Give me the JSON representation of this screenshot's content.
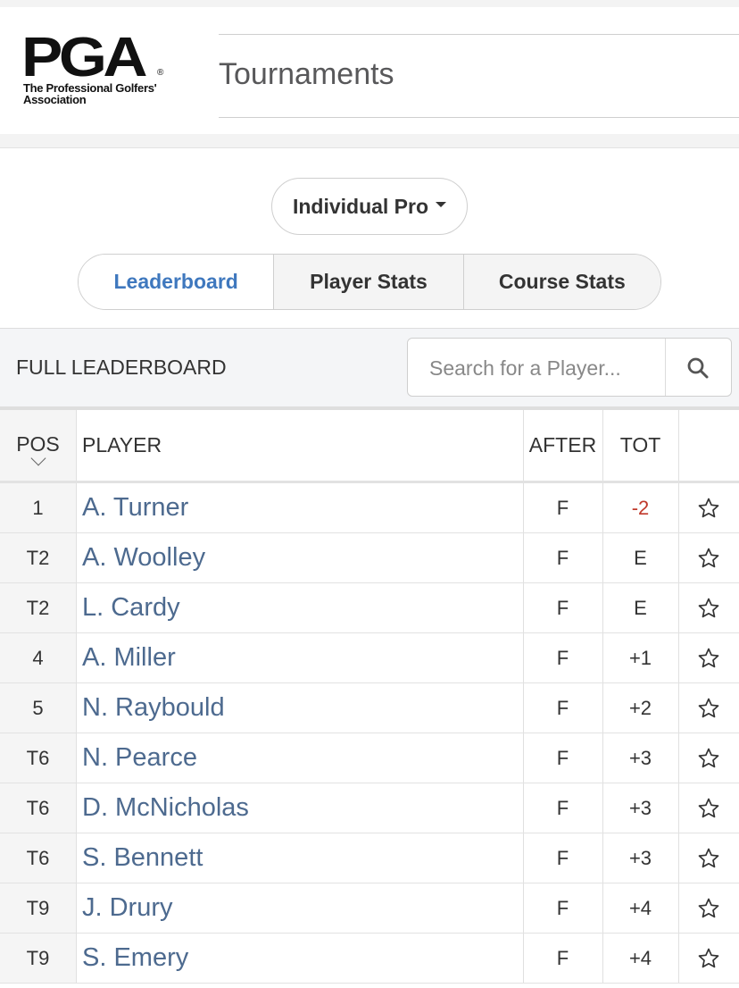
{
  "header": {
    "logo_mark": "PGA",
    "logo_reg": "®",
    "logo_sub_line1": "The Professional Golfers'",
    "logo_sub_line2": "Association",
    "title": "Tournaments"
  },
  "selector": {
    "label": "Individual Pro"
  },
  "tabs": [
    {
      "label": "Leaderboard",
      "active": true
    },
    {
      "label": "Player Stats",
      "active": false
    },
    {
      "label": "Course Stats",
      "active": false
    }
  ],
  "leaderboard": {
    "title": "FULL LEADERBOARD",
    "search_placeholder": "Search for a Player...",
    "columns": {
      "pos": "POS",
      "player": "PLAYER",
      "after": "AFTER",
      "tot": "TOT"
    },
    "rows": [
      {
        "pos": "1",
        "player": "A. Turner",
        "after": "F",
        "tot": "-2"
      },
      {
        "pos": "T2",
        "player": "A. Woolley",
        "after": "F",
        "tot": "E"
      },
      {
        "pos": "T2",
        "player": "L. Cardy",
        "after": "F",
        "tot": "E"
      },
      {
        "pos": "4",
        "player": "A. Miller",
        "after": "F",
        "tot": "+1"
      },
      {
        "pos": "5",
        "player": "N. Raybould",
        "after": "F",
        "tot": "+2"
      },
      {
        "pos": "T6",
        "player": "N. Pearce",
        "after": "F",
        "tot": "+3"
      },
      {
        "pos": "T6",
        "player": "D. McNicholas",
        "after": "F",
        "tot": "+3"
      },
      {
        "pos": "T6",
        "player": "S. Bennett",
        "after": "F",
        "tot": "+3"
      },
      {
        "pos": "T9",
        "player": "J. Drury",
        "after": "F",
        "tot": "+4"
      },
      {
        "pos": "T9",
        "player": "S. Emery",
        "after": "F",
        "tot": "+4"
      }
    ]
  },
  "colors": {
    "link": "#4d6a8f",
    "active_tab": "#3f78be",
    "under_par": "#c0392b"
  }
}
